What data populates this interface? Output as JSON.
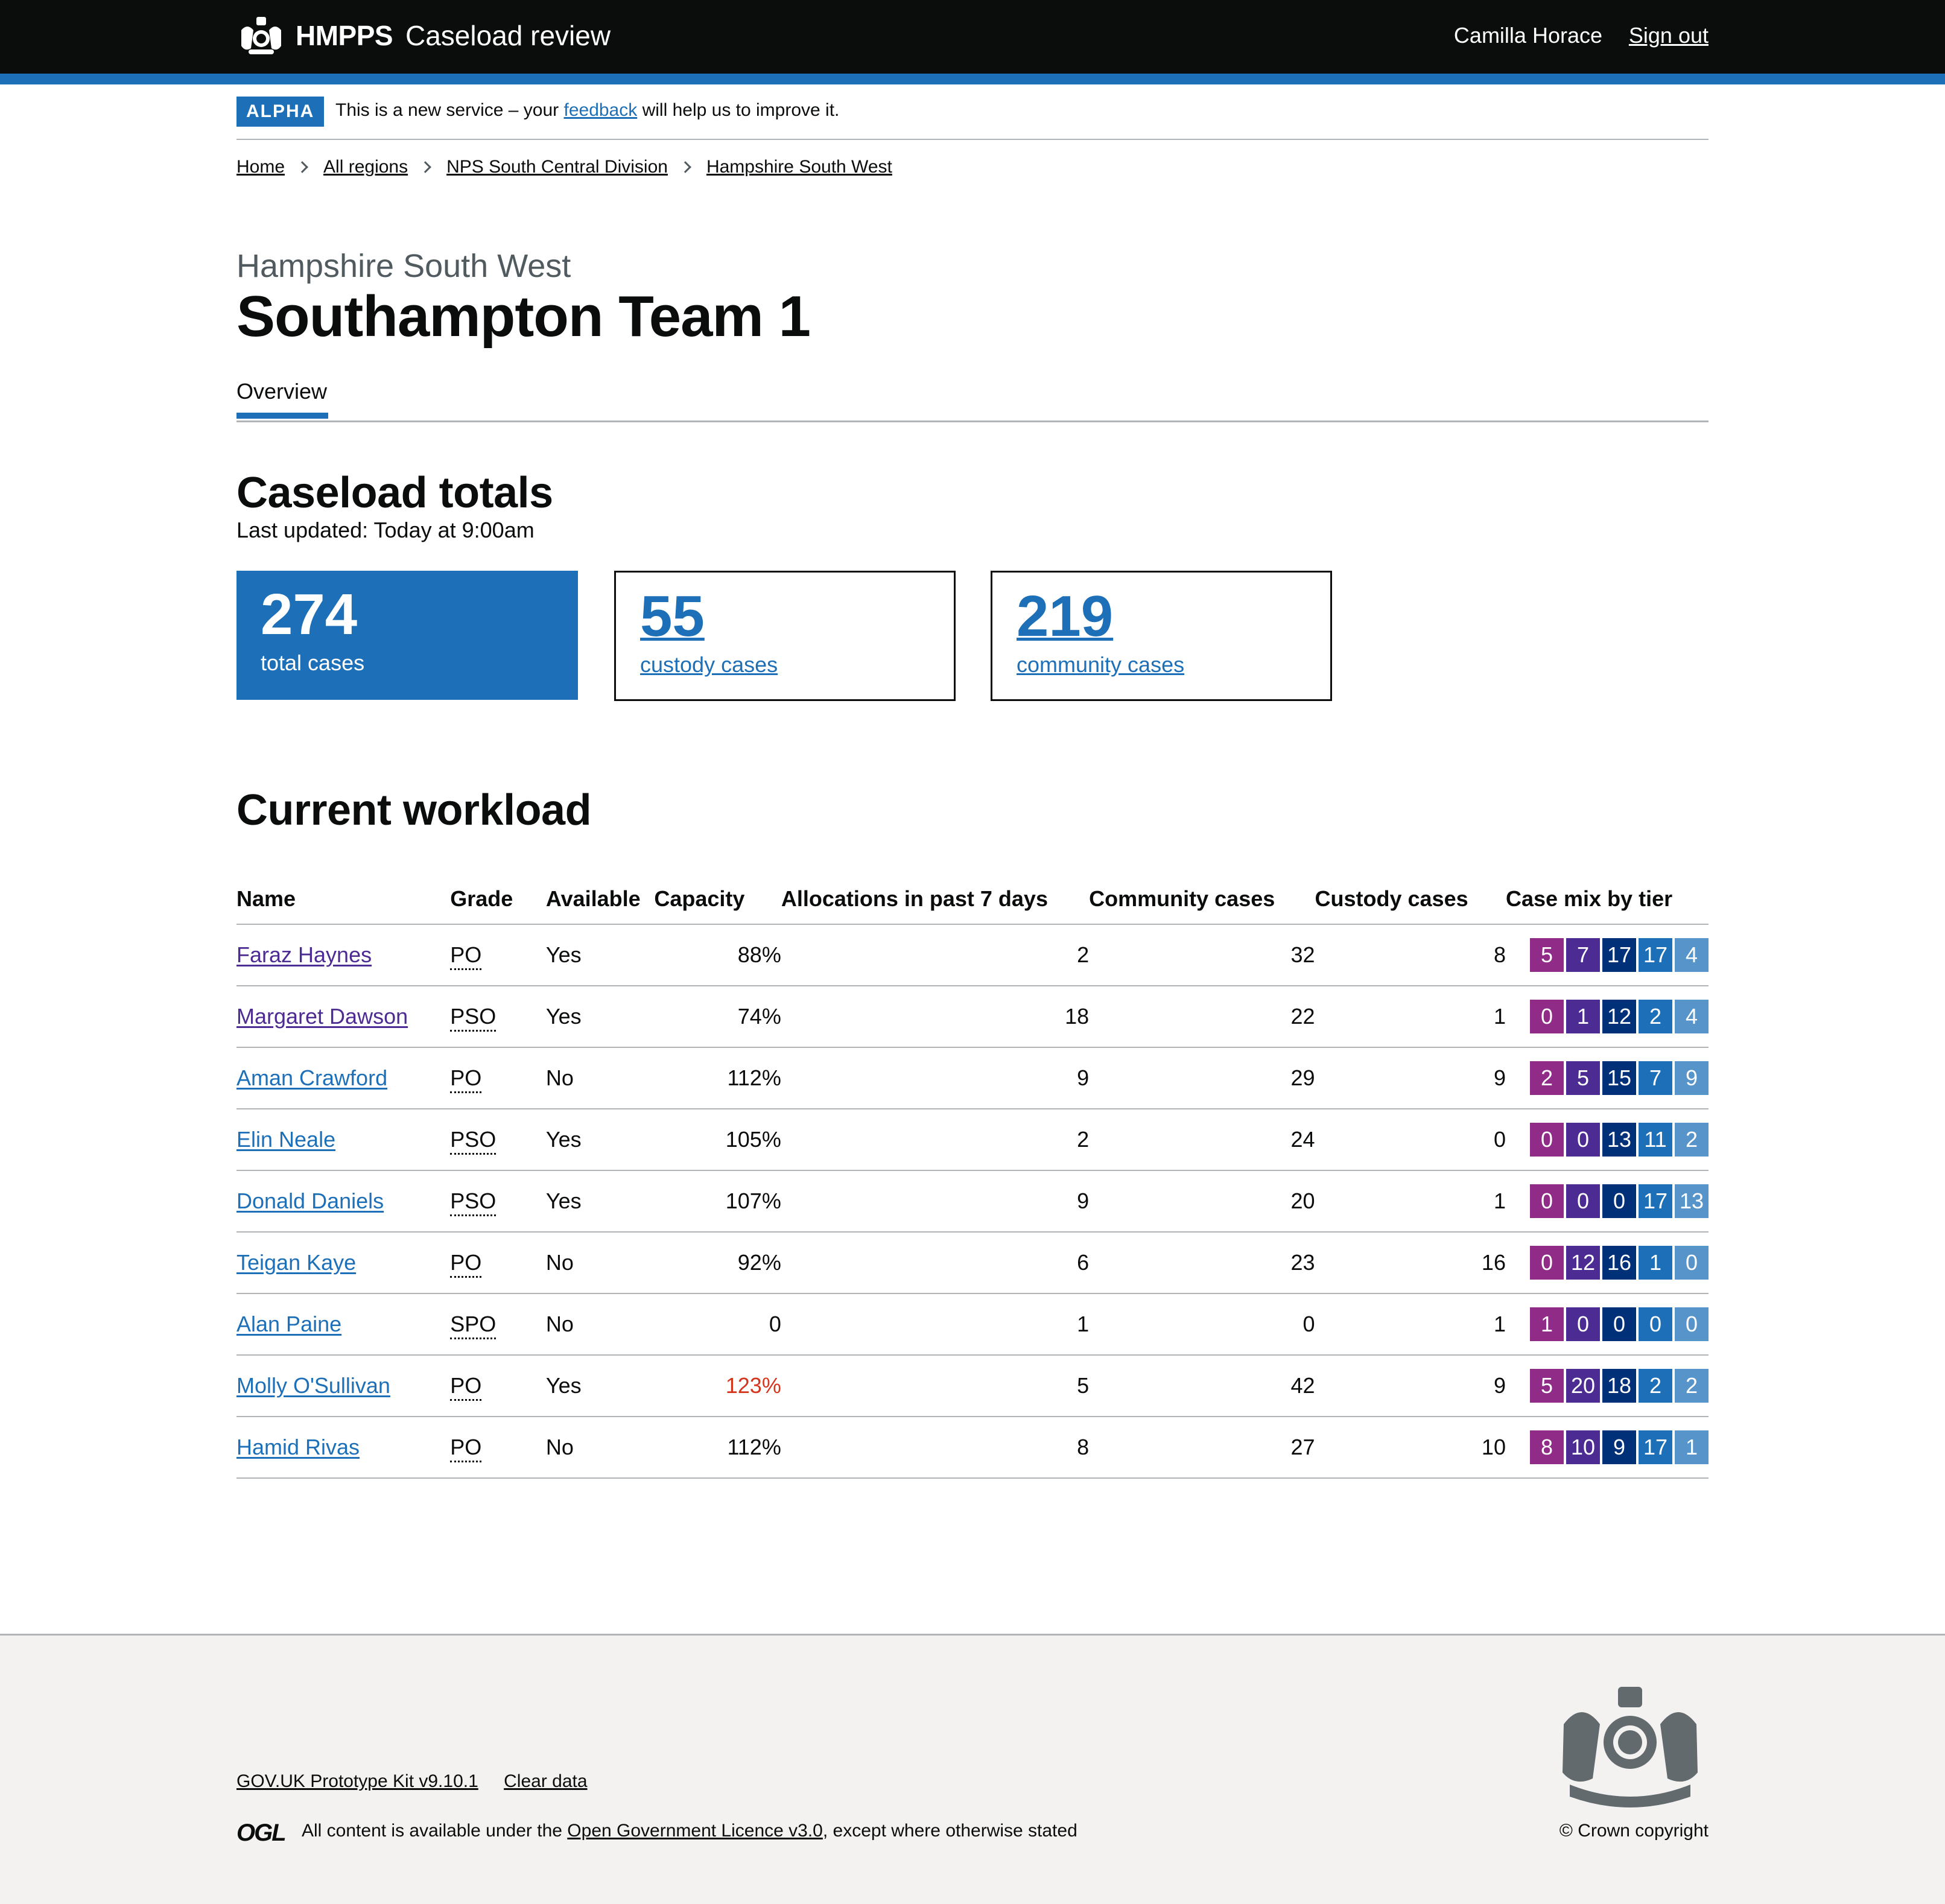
{
  "header": {
    "brand": "HMPPS",
    "service": "Caseload review",
    "user": "Camilla Horace",
    "sign_out": "Sign out",
    "logo_icon": "royal-crest-icon"
  },
  "phase_banner": {
    "tag": "ALPHA",
    "text_before": "This is a new service – your",
    "link": "feedback",
    "text_after": "will help us to improve it."
  },
  "breadcrumb": [
    "Home",
    "All regions",
    "NPS South Central Division",
    "Hampshire South West"
  ],
  "page": {
    "caption": "Hampshire South West",
    "title": "Southampton Team 1"
  },
  "tabs": [
    "Overview"
  ],
  "totals": {
    "heading": "Caseload totals",
    "updated": "Last updated: Today at 9:00am",
    "total": {
      "value": "274",
      "label": "total cases"
    },
    "custody": {
      "value": "55",
      "label": "custody cases"
    },
    "community": {
      "value": "219",
      "label": "community cases"
    }
  },
  "workload": {
    "heading": "Current workload",
    "columns": [
      "Name",
      "Grade",
      "Available",
      "Capacity",
      "Allocations in past 7 days",
      "Community cases",
      "Custody cases",
      "Case mix by tier"
    ],
    "tier_colors": [
      "#912b88",
      "#4c2c92",
      "#003078",
      "#1d70b8",
      "#5694ca"
    ],
    "rows": [
      {
        "name": "Faraz Haynes",
        "visited": true,
        "grade": "PO",
        "available": "Yes",
        "capacity": "88%",
        "over_capacity": false,
        "allocations": "2",
        "community": "32",
        "custody": "8",
        "tiers": [
          "5",
          "7",
          "17",
          "17",
          "4"
        ]
      },
      {
        "name": "Margaret Dawson",
        "visited": true,
        "grade": "PSO",
        "available": "Yes",
        "capacity": "74%",
        "over_capacity": false,
        "allocations": "18",
        "community": "22",
        "custody": "1",
        "tiers": [
          "0",
          "1",
          "12",
          "2",
          "4"
        ]
      },
      {
        "name": "Aman Crawford",
        "visited": false,
        "grade": "PO",
        "available": "No",
        "capacity": "112%",
        "over_capacity": false,
        "allocations": "9",
        "community": "29",
        "custody": "9",
        "tiers": [
          "2",
          "5",
          "15",
          "7",
          "9"
        ]
      },
      {
        "name": "Elin Neale",
        "visited": false,
        "grade": "PSO",
        "available": "Yes",
        "capacity": "105%",
        "over_capacity": false,
        "allocations": "2",
        "community": "24",
        "custody": "0",
        "tiers": [
          "0",
          "0",
          "13",
          "11",
          "2"
        ]
      },
      {
        "name": "Donald Daniels",
        "visited": false,
        "grade": "PSO",
        "available": "Yes",
        "capacity": "107%",
        "over_capacity": false,
        "allocations": "9",
        "community": "20",
        "custody": "1",
        "tiers": [
          "0",
          "0",
          "0",
          "17",
          "13"
        ]
      },
      {
        "name": "Teigan Kaye",
        "visited": false,
        "grade": "PO",
        "available": "No",
        "capacity": "92%",
        "over_capacity": false,
        "allocations": "6",
        "community": "23",
        "custody": "16",
        "tiers": [
          "0",
          "12",
          "16",
          "1",
          "0"
        ]
      },
      {
        "name": "Alan Paine",
        "visited": false,
        "grade": "SPO",
        "available": "No",
        "capacity": "0",
        "over_capacity": false,
        "allocations": "1",
        "community": "0",
        "custody": "1",
        "tiers": [
          "1",
          "0",
          "0",
          "0",
          "0"
        ]
      },
      {
        "name": "Molly O'Sullivan",
        "visited": false,
        "grade": "PO",
        "available": "Yes",
        "capacity": "123%",
        "over_capacity": true,
        "allocations": "5",
        "community": "42",
        "custody": "9",
        "tiers": [
          "5",
          "20",
          "18",
          "2",
          "2"
        ]
      },
      {
        "name": "Hamid Rivas",
        "visited": false,
        "grade": "PO",
        "available": "No",
        "capacity": "112%",
        "over_capacity": false,
        "allocations": "8",
        "community": "27",
        "custody": "10",
        "tiers": [
          "8",
          "10",
          "9",
          "17",
          "1"
        ]
      }
    ]
  },
  "footer": {
    "links": [
      "GOV.UK Prototype Kit v9.10.1",
      "Clear data"
    ],
    "ogl_logo": "OGL",
    "licence_before": "All content is available under the",
    "licence_link": "Open Government Licence v3.0",
    "licence_after": ", except where otherwise stated",
    "copyright": "© Crown copyright",
    "crest_icon": "royal-coat-of-arms-icon"
  }
}
